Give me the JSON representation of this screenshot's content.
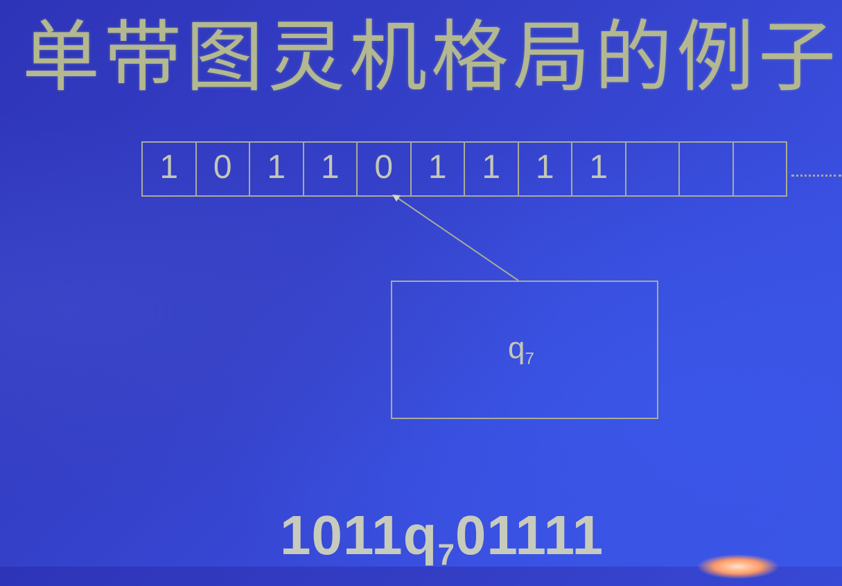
{
  "slide": {
    "title": "单带图灵机格局的例子",
    "tape": {
      "cells": [
        "1",
        "0",
        "1",
        "1",
        "0",
        "1",
        "1",
        "1",
        "1",
        "",
        "",
        ""
      ],
      "head_position_index": 4
    },
    "state": {
      "symbol": "q",
      "subscript": "7"
    },
    "configuration": {
      "left": "1011",
      "state_symbol": "q",
      "state_subscript": "7",
      "right": "01111"
    }
  },
  "colors": {
    "background": "#3440c8",
    "foreground": "#c4c7b4",
    "title": "#b3b890"
  }
}
